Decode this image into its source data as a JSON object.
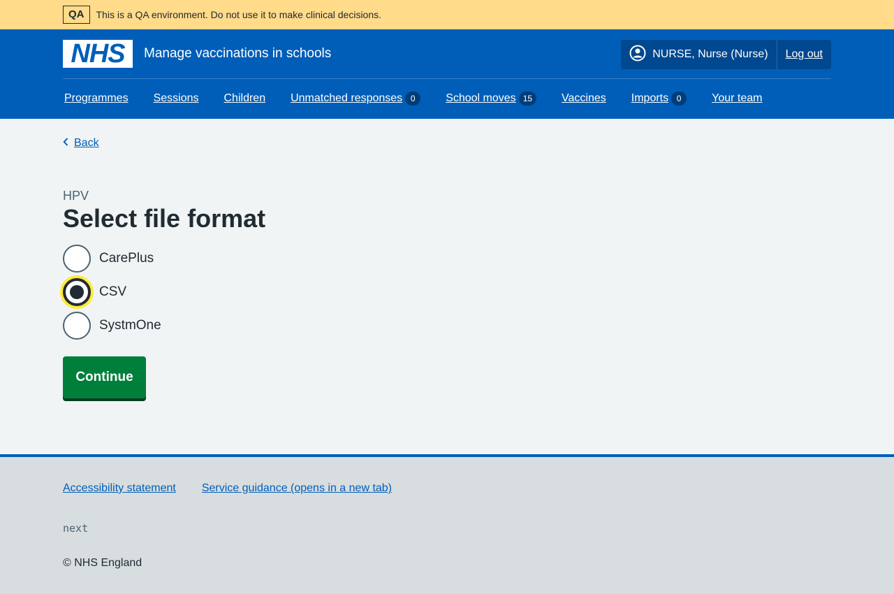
{
  "env_banner": {
    "tag": "QA",
    "message": "This is a QA environment. Do not use it to make clinical decisions."
  },
  "header": {
    "logo_text": "NHS",
    "service_name": "Manage vaccinations in schools",
    "user_label": "NURSE, Nurse (Nurse)",
    "logout_label": "Log out"
  },
  "nav": {
    "items": [
      {
        "label": "Programmes"
      },
      {
        "label": "Sessions"
      },
      {
        "label": "Children"
      },
      {
        "label": "Unmatched responses",
        "count": "0"
      },
      {
        "label": "School moves",
        "count": "15"
      },
      {
        "label": "Vaccines"
      },
      {
        "label": "Imports",
        "count": "0"
      },
      {
        "label": "Your team"
      }
    ]
  },
  "main": {
    "back_label": "Back",
    "caption": "HPV",
    "title": "Select file format",
    "options": [
      {
        "label": "CarePlus",
        "selected": false
      },
      {
        "label": "CSV",
        "selected": true
      },
      {
        "label": "SystmOne",
        "selected": false
      }
    ],
    "continue_label": "Continue"
  },
  "footer": {
    "links": [
      {
        "label": "Accessibility statement"
      },
      {
        "label": "Service guidance (opens in a new tab)"
      }
    ],
    "version": "next",
    "copyright": "© NHS England"
  },
  "colors": {
    "nhs_blue": "#005eb8",
    "banner_yellow": "#ffdb8a",
    "button_green": "#007f3b",
    "focus_yellow": "#ffeb3b"
  }
}
